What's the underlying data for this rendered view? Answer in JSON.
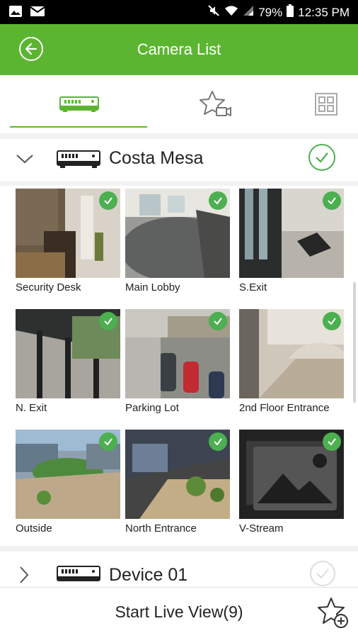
{
  "status": {
    "battery": "79%",
    "time": "12:35 PM"
  },
  "header": {
    "title": "Camera List"
  },
  "tabs": [
    {
      "name": "devices",
      "icon": "nvr-device-icon"
    },
    {
      "name": "favorites",
      "icon": "star-camera-icon"
    },
    {
      "name": "view",
      "icon": "grid-view-icon"
    }
  ],
  "group": {
    "name": "Costa Mesa",
    "selected": true
  },
  "cameras": [
    {
      "name": "Security Desk",
      "checked": true
    },
    {
      "name": "Main Lobby",
      "checked": true
    },
    {
      "name": "S.Exit",
      "checked": true
    },
    {
      "name": "N. Exit",
      "checked": true
    },
    {
      "name": "Parking Lot",
      "checked": true
    },
    {
      "name": "2nd Floor Entrance",
      "checked": true
    },
    {
      "name": "Outside",
      "checked": true
    },
    {
      "name": "North Entrance",
      "checked": true
    },
    {
      "name": "V-Stream",
      "checked": true
    }
  ],
  "device2": {
    "name": "Device 01",
    "selected": false
  },
  "footer": {
    "start_label": "Start Live View(9)"
  },
  "colors": {
    "accent": "#5cb531",
    "check": "#4caf50"
  }
}
